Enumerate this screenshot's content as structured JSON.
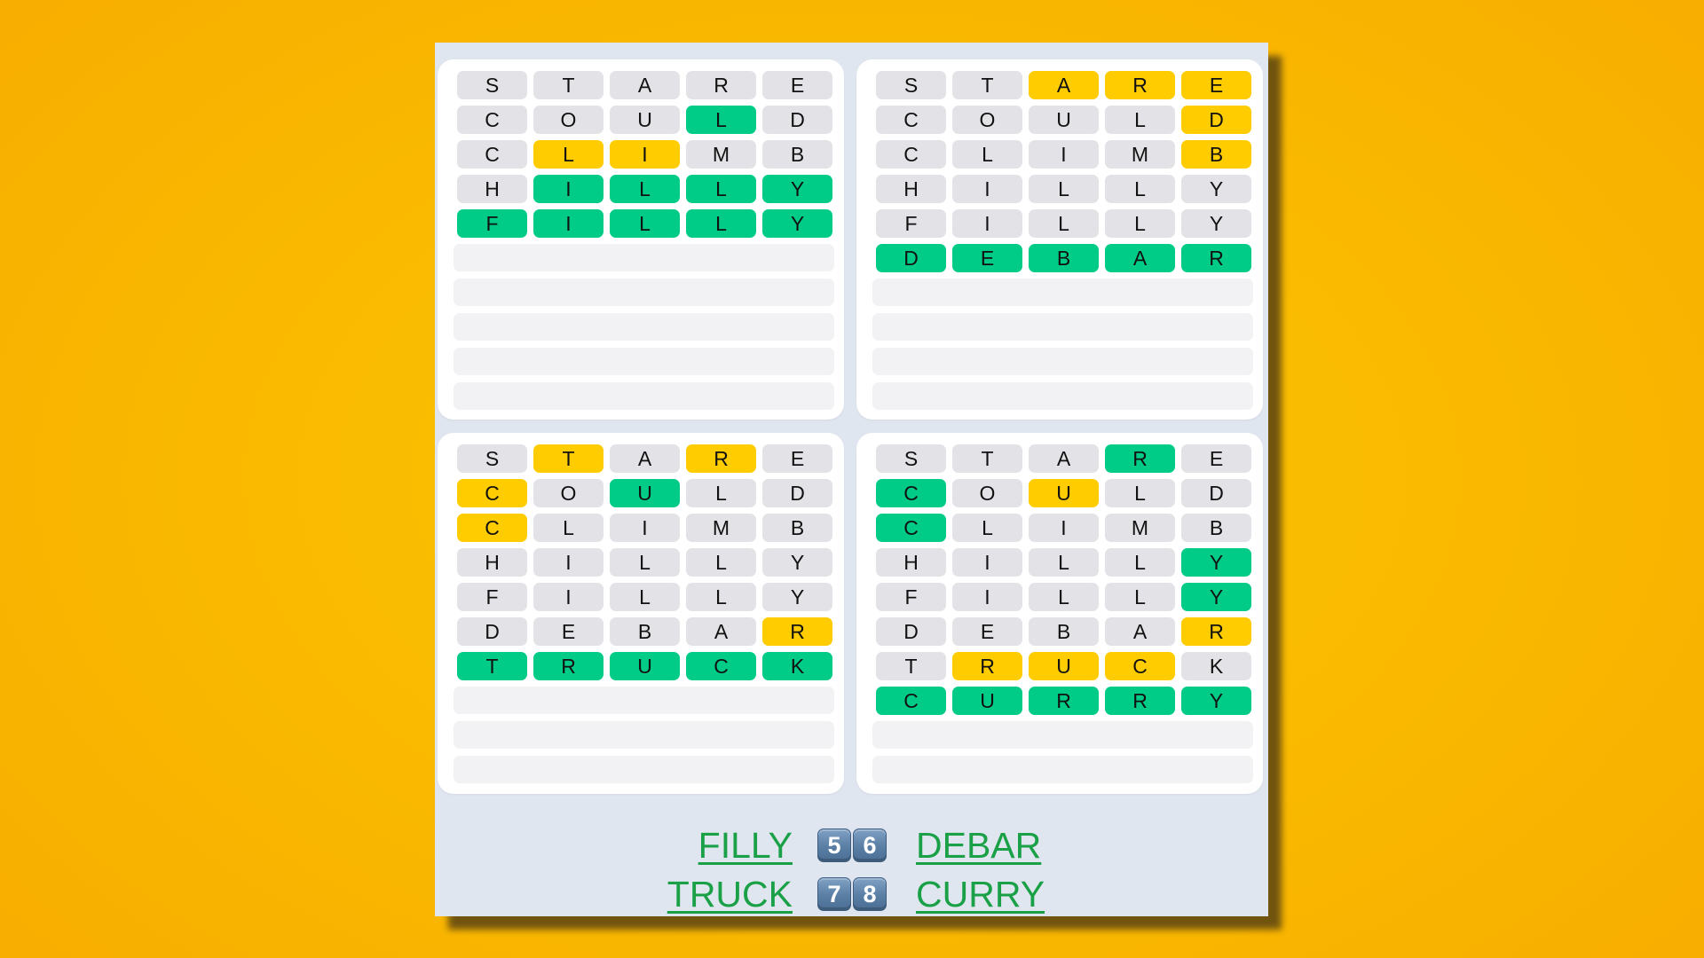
{
  "colors": {
    "background": "#f9b800",
    "panel": "#e0e6ef",
    "card": "#ffffff",
    "tile_absent": "#e3e3e7",
    "tile_present": "#ffcc00",
    "tile_correct": "#00cc88",
    "empty_row": "#f2f2f4",
    "answer_link": "#1aa047",
    "keycap": "#5a7ea4"
  },
  "boards": [
    {
      "id": "top-left",
      "empty_rows": 5,
      "rows": [
        {
          "letters": [
            "S",
            "T",
            "A",
            "R",
            "E"
          ],
          "states": [
            "absent",
            "absent",
            "absent",
            "absent",
            "absent"
          ]
        },
        {
          "letters": [
            "C",
            "O",
            "U",
            "L",
            "D"
          ],
          "states": [
            "absent",
            "absent",
            "absent",
            "correct",
            "absent"
          ]
        },
        {
          "letters": [
            "C",
            "L",
            "I",
            "M",
            "B"
          ],
          "states": [
            "absent",
            "present",
            "present",
            "absent",
            "absent"
          ]
        },
        {
          "letters": [
            "H",
            "I",
            "L",
            "L",
            "Y"
          ],
          "states": [
            "absent",
            "correct",
            "correct",
            "correct",
            "correct"
          ]
        },
        {
          "letters": [
            "F",
            "I",
            "L",
            "L",
            "Y"
          ],
          "states": [
            "correct",
            "correct",
            "correct",
            "correct",
            "correct"
          ]
        }
      ]
    },
    {
      "id": "top-right",
      "empty_rows": 4,
      "rows": [
        {
          "letters": [
            "S",
            "T",
            "A",
            "R",
            "E"
          ],
          "states": [
            "absent",
            "absent",
            "present",
            "present",
            "present"
          ]
        },
        {
          "letters": [
            "C",
            "O",
            "U",
            "L",
            "D"
          ],
          "states": [
            "absent",
            "absent",
            "absent",
            "absent",
            "present"
          ]
        },
        {
          "letters": [
            "C",
            "L",
            "I",
            "M",
            "B"
          ],
          "states": [
            "absent",
            "absent",
            "absent",
            "absent",
            "present"
          ]
        },
        {
          "letters": [
            "H",
            "I",
            "L",
            "L",
            "Y"
          ],
          "states": [
            "absent",
            "absent",
            "absent",
            "absent",
            "absent"
          ]
        },
        {
          "letters": [
            "F",
            "I",
            "L",
            "L",
            "Y"
          ],
          "states": [
            "absent",
            "absent",
            "absent",
            "absent",
            "absent"
          ]
        },
        {
          "letters": [
            "D",
            "E",
            "B",
            "A",
            "R"
          ],
          "states": [
            "correct",
            "correct",
            "correct",
            "correct",
            "correct"
          ]
        }
      ]
    },
    {
      "id": "bottom-left",
      "empty_rows": 3,
      "rows": [
        {
          "letters": [
            "S",
            "T",
            "A",
            "R",
            "E"
          ],
          "states": [
            "absent",
            "present",
            "absent",
            "present",
            "absent"
          ]
        },
        {
          "letters": [
            "C",
            "O",
            "U",
            "L",
            "D"
          ],
          "states": [
            "present",
            "absent",
            "correct",
            "absent",
            "absent"
          ]
        },
        {
          "letters": [
            "C",
            "L",
            "I",
            "M",
            "B"
          ],
          "states": [
            "present",
            "absent",
            "absent",
            "absent",
            "absent"
          ]
        },
        {
          "letters": [
            "H",
            "I",
            "L",
            "L",
            "Y"
          ],
          "states": [
            "absent",
            "absent",
            "absent",
            "absent",
            "absent"
          ]
        },
        {
          "letters": [
            "F",
            "I",
            "L",
            "L",
            "Y"
          ],
          "states": [
            "absent",
            "absent",
            "absent",
            "absent",
            "absent"
          ]
        },
        {
          "letters": [
            "D",
            "E",
            "B",
            "A",
            "R"
          ],
          "states": [
            "absent",
            "absent",
            "absent",
            "absent",
            "present"
          ]
        },
        {
          "letters": [
            "T",
            "R",
            "U",
            "C",
            "K"
          ],
          "states": [
            "correct",
            "correct",
            "correct",
            "correct",
            "correct"
          ]
        }
      ]
    },
    {
      "id": "bottom-right",
      "empty_rows": 2,
      "rows": [
        {
          "letters": [
            "S",
            "T",
            "A",
            "R",
            "E"
          ],
          "states": [
            "absent",
            "absent",
            "absent",
            "correct",
            "absent"
          ]
        },
        {
          "letters": [
            "C",
            "O",
            "U",
            "L",
            "D"
          ],
          "states": [
            "correct",
            "absent",
            "present",
            "absent",
            "absent"
          ]
        },
        {
          "letters": [
            "C",
            "L",
            "I",
            "M",
            "B"
          ],
          "states": [
            "correct",
            "absent",
            "absent",
            "absent",
            "absent"
          ]
        },
        {
          "letters": [
            "H",
            "I",
            "L",
            "L",
            "Y"
          ],
          "states": [
            "absent",
            "absent",
            "absent",
            "absent",
            "correct"
          ]
        },
        {
          "letters": [
            "F",
            "I",
            "L",
            "L",
            "Y"
          ],
          "states": [
            "absent",
            "absent",
            "absent",
            "absent",
            "correct"
          ]
        },
        {
          "letters": [
            "D",
            "E",
            "B",
            "A",
            "R"
          ],
          "states": [
            "absent",
            "absent",
            "absent",
            "absent",
            "present"
          ]
        },
        {
          "letters": [
            "T",
            "R",
            "U",
            "C",
            "K"
          ],
          "states": [
            "absent",
            "present",
            "present",
            "present",
            "absent"
          ]
        },
        {
          "letters": [
            "C",
            "U",
            "R",
            "R",
            "Y"
          ],
          "states": [
            "correct",
            "correct",
            "correct",
            "correct",
            "correct"
          ]
        }
      ]
    }
  ],
  "answers": {
    "line1": {
      "left_word": "FILLY",
      "keycaps": [
        "5",
        "6"
      ],
      "right_word": "DEBAR"
    },
    "line2": {
      "left_word": "TRUCK",
      "keycaps": [
        "7",
        "8"
      ],
      "right_word": "CURRY"
    }
  }
}
